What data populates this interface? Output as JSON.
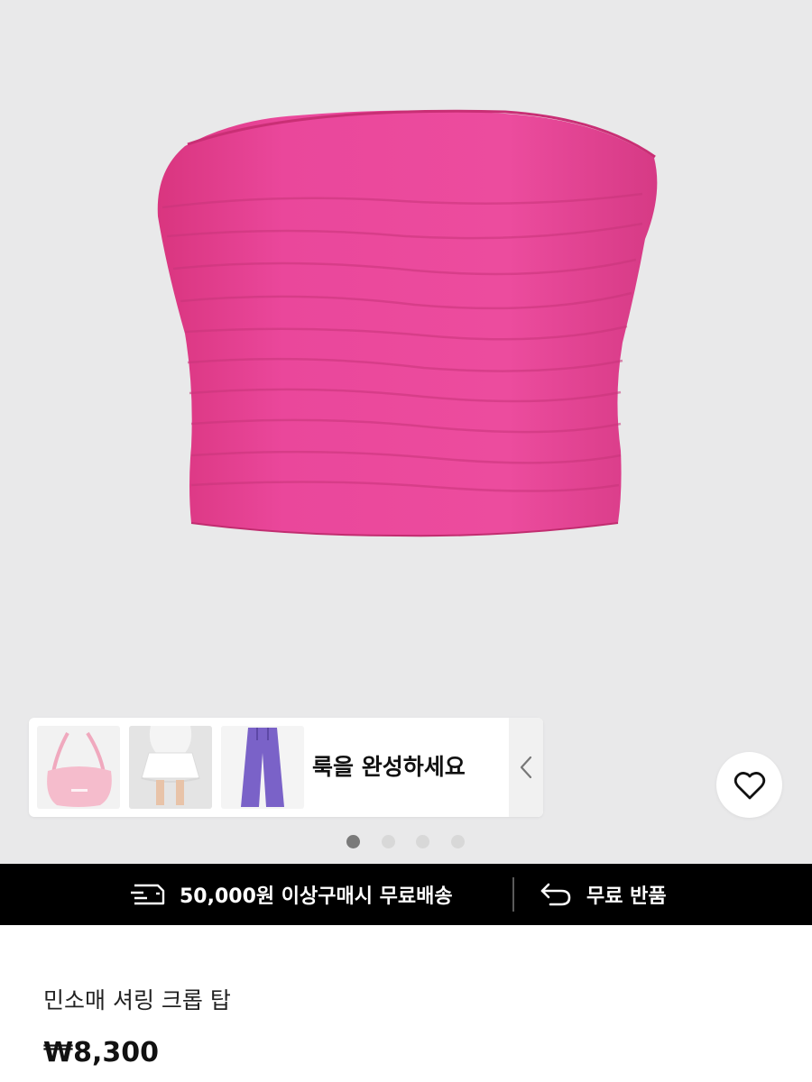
{
  "look": {
    "label": "룩을 완성하세요",
    "thumbnails": [
      {
        "name": "pink tote bag"
      },
      {
        "name": "white ruffle skirt outfit"
      },
      {
        "name": "purple wide pants"
      }
    ],
    "arrow_icon": "chevron-left-icon"
  },
  "gallery": {
    "image_count": 4,
    "active_index": 0
  },
  "wishlist": {
    "icon": "heart-icon"
  },
  "promo": {
    "shipping_icon": "delivery-truck-icon",
    "shipping_text": "50,000원 이상구매시 무료배송",
    "return_icon": "return-arrow-icon",
    "return_text": "무료 반품"
  },
  "product": {
    "title": "민소매 셔링 크롭 탑",
    "price": "₩8,300",
    "color": "#e8449a"
  }
}
